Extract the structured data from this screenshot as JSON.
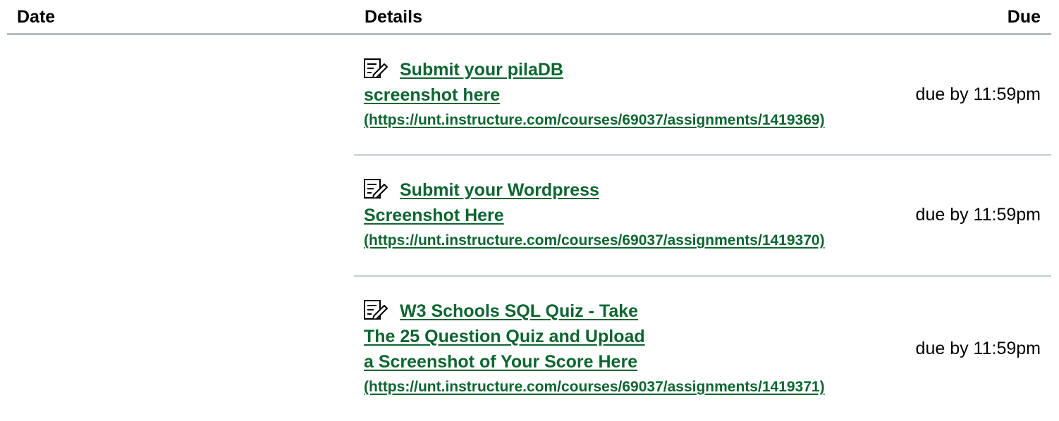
{
  "header": {
    "date": "Date",
    "details": "Details",
    "due": "Due"
  },
  "rows": [
    {
      "title_line1": "Submit your pilaDB",
      "title_line2": "screenshot here",
      "title_line3": "",
      "url": "(https://unt.instructure.com/courses/69037/assignments/1419369)",
      "due": "due by 11:59pm",
      "icon": "assignment-icon"
    },
    {
      "title_line1": "Submit your Wordpress",
      "title_line2": "Screenshot Here",
      "title_line3": "",
      "url": "(https://unt.instructure.com/courses/69037/assignments/1419370)",
      "due": "due by 11:59pm",
      "icon": "assignment-icon"
    },
    {
      "title_line1": "W3 Schools SQL Quiz - Take",
      "title_line2": "The 25 Question Quiz and Upload",
      "title_line3": "a Screenshot of Your Score Here",
      "url": "(https://unt.instructure.com/courses/69037/assignments/1419371)",
      "due": "due by 11:59pm",
      "icon": "assignment-icon"
    }
  ],
  "colors": {
    "link": "#0d6530",
    "header_border": "#b6bcc4",
    "row_border": "#c7cdd1"
  }
}
